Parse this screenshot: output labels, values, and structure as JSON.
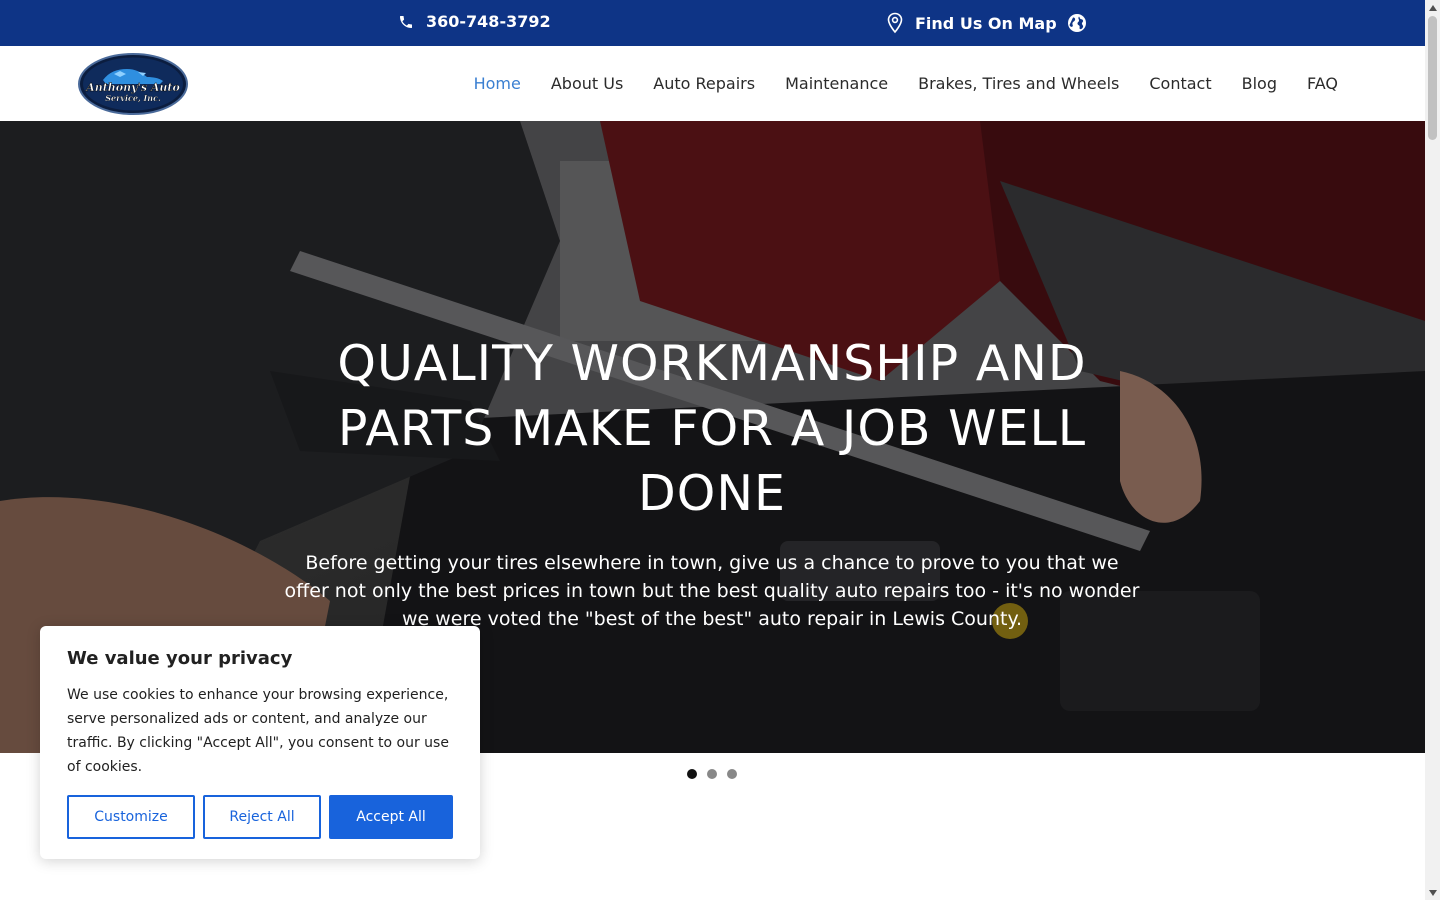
{
  "topbar": {
    "phone": "360-748-3792",
    "map_label": "Find Us On Map",
    "icons": [
      "phone-icon",
      "map-pin-icon",
      "globe-icon"
    ]
  },
  "logo": {
    "line1": "Anthony's Auto",
    "line2": "Service, Inc."
  },
  "nav": {
    "items": [
      "Home",
      "About Us",
      "Auto Repairs",
      "Maintenance",
      "Brakes, Tires and Wheels",
      "Contact",
      "Blog",
      "FAQ"
    ],
    "active": "Home"
  },
  "hero": {
    "title": "QUALITY WORKMANSHIP AND PARTS MAKE FOR A JOB WELL DONE",
    "subtitle": "Before getting your tires elsewhere in town, give us a chance to prove to you that we offer not only the best prices in town but the best quality auto repairs too - it's no wonder we were voted the \"best of the best\" auto repair in Lewis County."
  },
  "slider": {
    "slide_count": 3,
    "active_index": 0
  },
  "cookie": {
    "title": "We value your privacy",
    "body": "We use cookies to enhance your browsing experience, serve personalized ads or content, and analyze our traffic. By clicking \"Accept All\", you consent to our use of cookies.",
    "customize_label": "Customize",
    "reject_label": "Reject All",
    "accept_label": "Accept All"
  },
  "colors": {
    "topbar_bg": "#0e3486",
    "nav_active": "#3a7fd1",
    "cookie_accent": "#1863dc"
  }
}
